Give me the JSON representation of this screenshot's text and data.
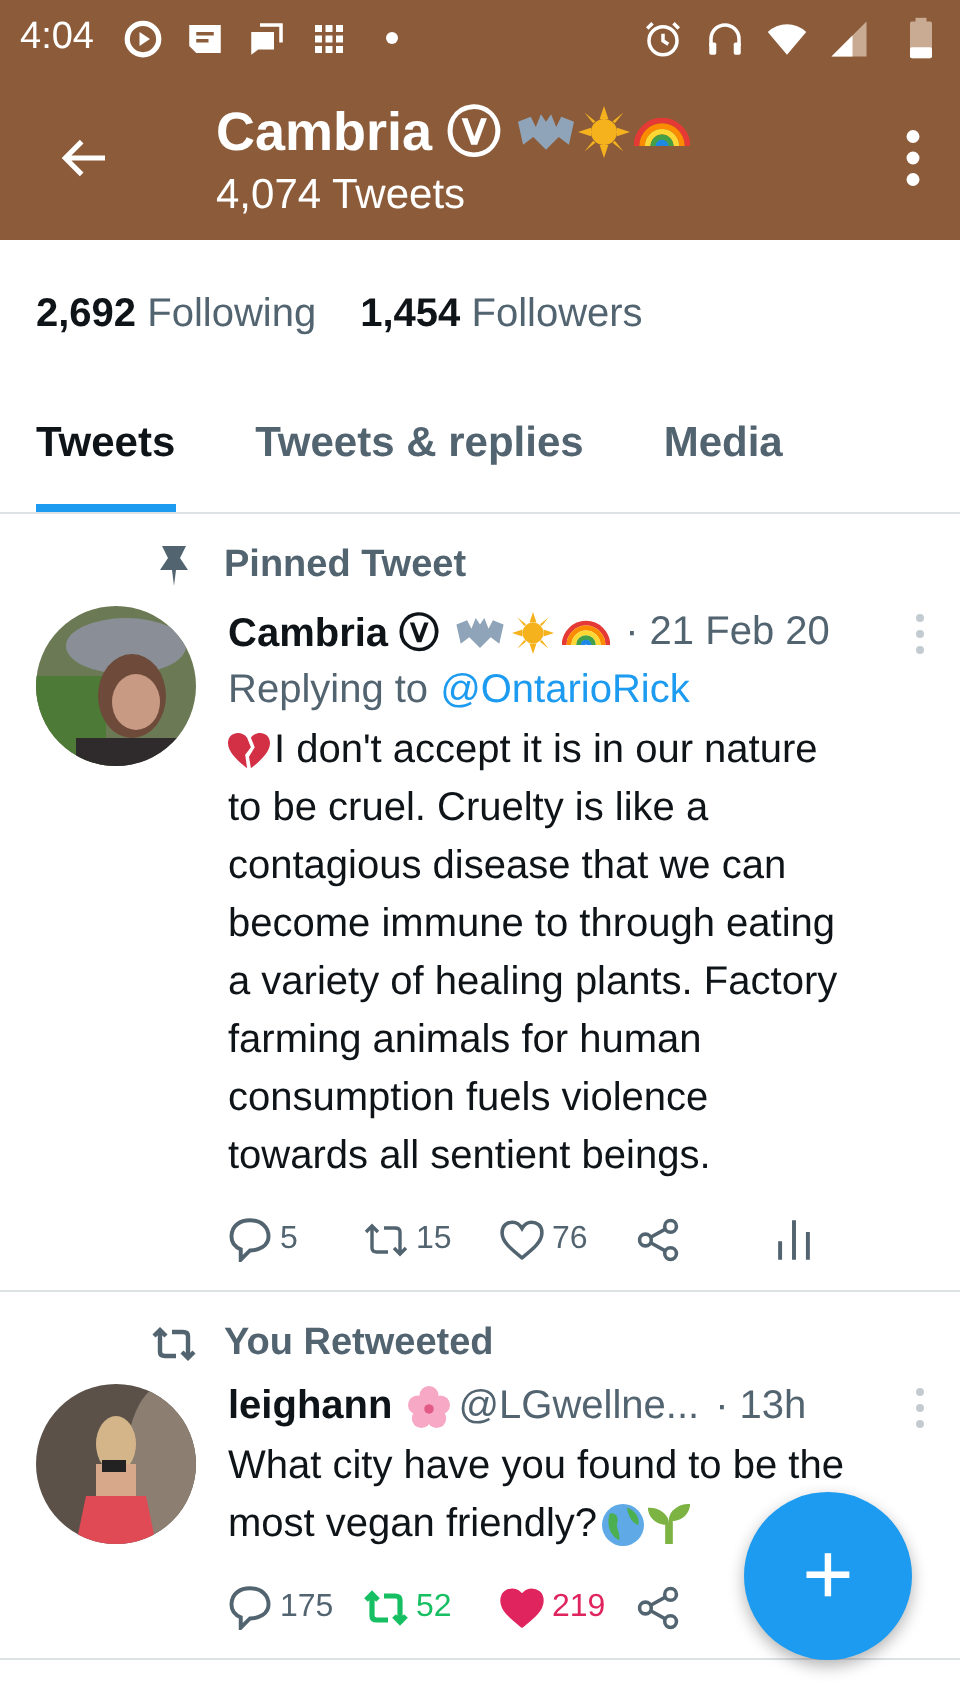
{
  "status_bar": {
    "time": "4:04"
  },
  "header": {
    "name": "Cambria ⓥ",
    "subtitle": "4,074 Tweets"
  },
  "stats": [
    {
      "count": "2,692",
      "label": "Following"
    },
    {
      "count": "1,454",
      "label": "Followers"
    }
  ],
  "tabs": [
    {
      "label": "Tweets",
      "selected": true
    },
    {
      "label": "Tweets & replies",
      "selected": false
    },
    {
      "label": "Media",
      "selected": false
    }
  ],
  "tweets": [
    {
      "context": {
        "kind": "pinned",
        "text": "Pinned Tweet"
      },
      "name": "Cambria ⓥ",
      "time": "· 21 Feb 20",
      "replying": {
        "prefix": "Replying to",
        "handle": "@OntarioRick"
      },
      "lines": [
        "I don't accept it is in our nature",
        "to be cruel. Cruelty is like a",
        "contagious disease that we can",
        "become immune to through eating",
        "a variety of healing plants. Factory",
        "farming animals for human",
        "consumption fuels violence",
        "towards all sentient beings."
      ],
      "actions": [
        {
          "kind": "reply",
          "count": "5",
          "active": false
        },
        {
          "kind": "retweet",
          "count": "15",
          "active": false
        },
        {
          "kind": "like",
          "count": "76",
          "active": false
        },
        {
          "kind": "share"
        },
        {
          "kind": "stats"
        }
      ]
    },
    {
      "context": {
        "kind": "retweeted",
        "text": "You Retweeted"
      },
      "name": "leighann",
      "handle": "@LGwellne...",
      "time": "· 13h",
      "lines": [
        "What city have you found to be the",
        "most vegan friendly?"
      ],
      "actions": [
        {
          "kind": "reply",
          "count": "175",
          "active": false
        },
        {
          "kind": "retweet",
          "count": "52",
          "active": true
        },
        {
          "kind": "like",
          "count": "219",
          "active": true
        },
        {
          "kind": "share"
        }
      ]
    }
  ],
  "fab": {
    "label": "+"
  }
}
